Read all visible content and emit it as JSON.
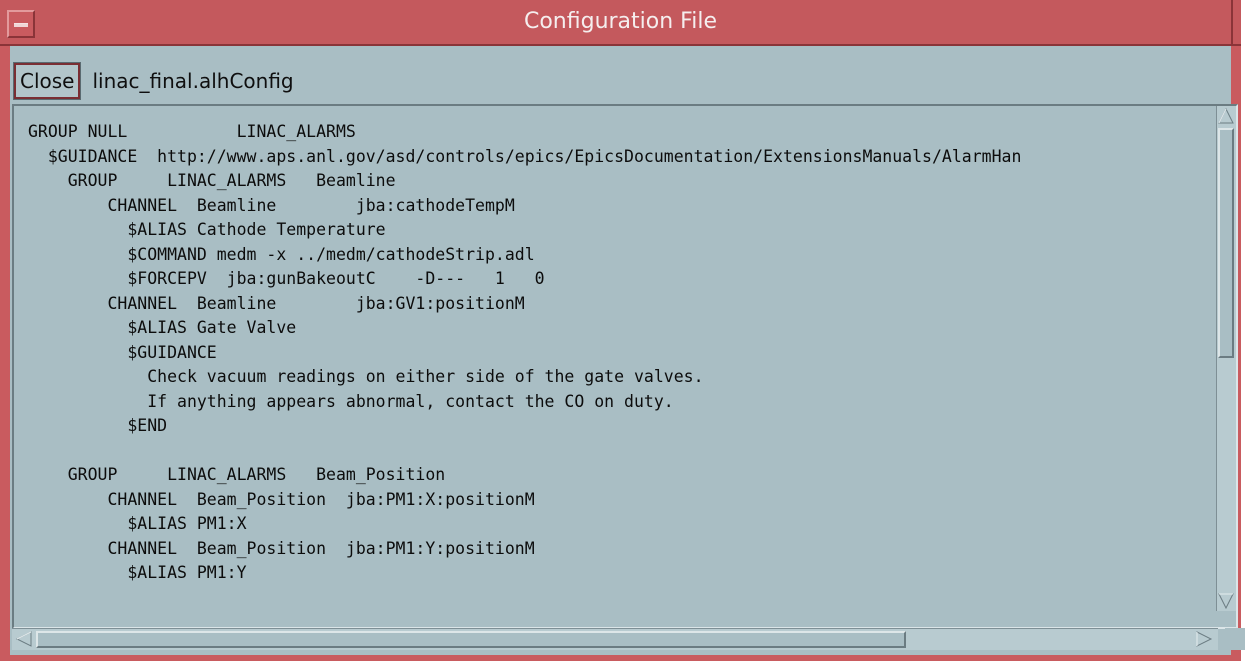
{
  "window": {
    "title": "Configuration File"
  },
  "toolbar": {
    "close_label": "Close",
    "filename": "linac_final.alhConfig"
  },
  "file": {
    "text": "GROUP NULL           LINAC_ALARMS\n  $GUIDANCE  http://www.aps.anl.gov/asd/controls/epics/EpicsDocumentation/ExtensionsManuals/AlarmHan\n    GROUP     LINAC_ALARMS   Beamline\n        CHANNEL  Beamline        jba:cathodeTempM\n          $ALIAS Cathode Temperature\n          $COMMAND medm -x ../medm/cathodeStrip.adl\n          $FORCEPV  jba:gunBakeoutC    -D---   1   0\n        CHANNEL  Beamline        jba:GV1:positionM\n          $ALIAS Gate Valve\n          $GUIDANCE\n            Check vacuum readings on either side of the gate valves.\n            If anything appears abnormal, contact the CO on duty.\n          $END\n\n    GROUP     LINAC_ALARMS   Beam_Position\n        CHANNEL  Beam_Position  jba:PM1:X:positionM\n          $ALIAS PM1:X\n        CHANNEL  Beam_Position  jba:PM1:Y:positionM\n          $ALIAS PM1:Y"
  },
  "colors": {
    "titlebar": "#c4595d",
    "background": "#a9bec4"
  }
}
